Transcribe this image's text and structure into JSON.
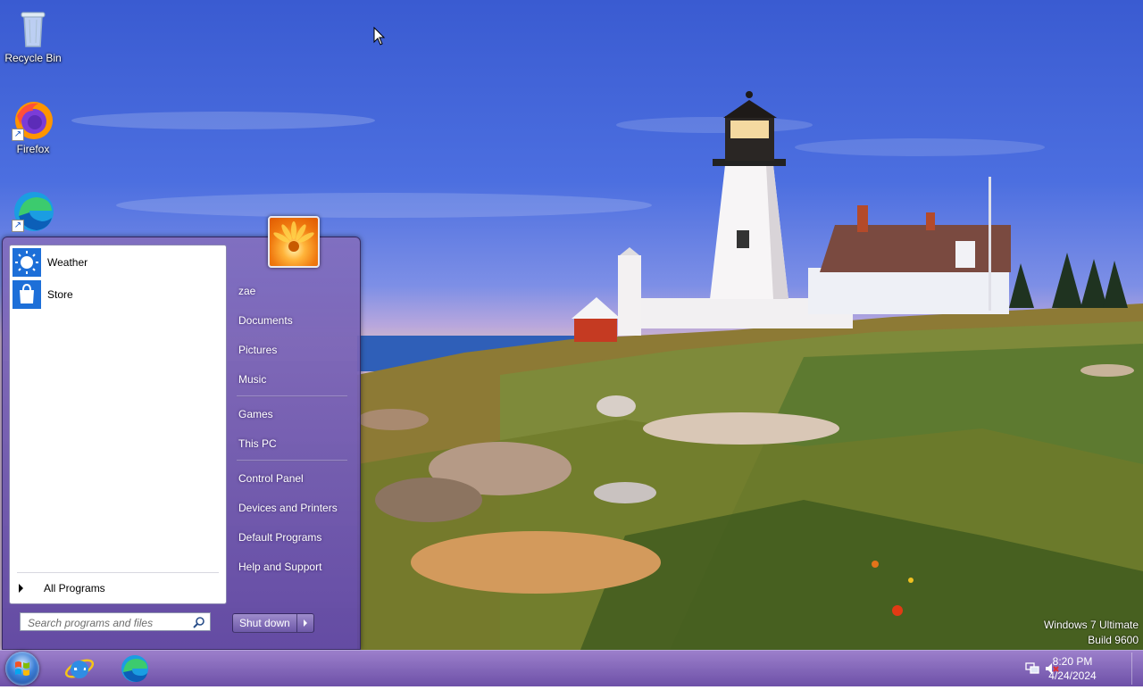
{
  "desktop": {
    "icons": [
      {
        "label": "Recycle Bin",
        "icon": "recycle-bin-icon"
      },
      {
        "label": "Firefox",
        "icon": "firefox-icon"
      },
      {
        "label": "",
        "icon": "edge-icon"
      }
    ]
  },
  "start_menu": {
    "pinned": [
      {
        "label": "Weather",
        "icon": "weather-icon"
      },
      {
        "label": "Store",
        "icon": "store-icon"
      }
    ],
    "all_programs": "All Programs",
    "search_placeholder": "Search programs and files",
    "user_name": "zae",
    "right_items": {
      "documents": "Documents",
      "pictures": "Pictures",
      "music": "Music",
      "games": "Games",
      "this_pc": "This PC",
      "control_panel": "Control Panel",
      "devices": "Devices and Printers",
      "default_programs": "Default Programs",
      "help": "Help and Support"
    },
    "shutdown": "Shut down"
  },
  "watermark": {
    "edition": "Windows 7 Ultimate",
    "build": "Build 9600"
  },
  "taskbar": {
    "apps": [
      "internet-explorer-icon",
      "edge-icon"
    ],
    "time": "8:20 PM",
    "date": "4/24/2024"
  },
  "colors": {
    "start_menu": "#7b63b8",
    "taskbar": "#8a6cc0",
    "sky": "#3a5bd1"
  }
}
